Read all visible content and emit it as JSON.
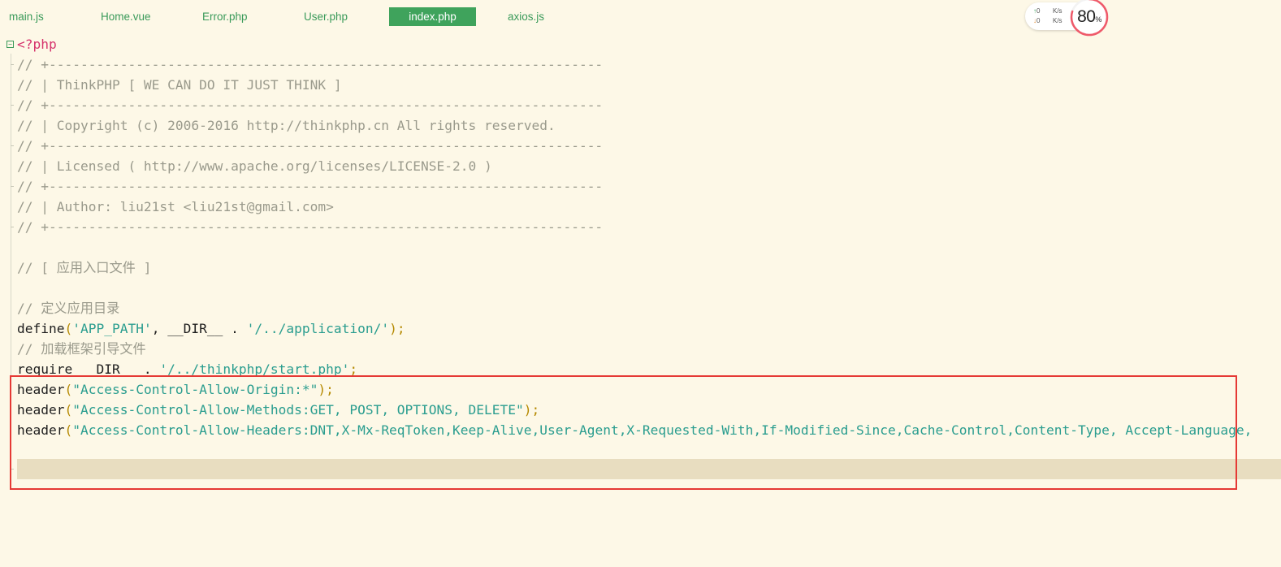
{
  "tabs": [
    {
      "label": "main.js",
      "active": false
    },
    {
      "label": "Home.vue",
      "active": false
    },
    {
      "label": "Error.php",
      "active": false
    },
    {
      "label": "User.php",
      "active": false
    },
    {
      "label": "index.php",
      "active": true
    },
    {
      "label": "axios.js",
      "active": false
    }
  ],
  "network": {
    "upload_value": "0",
    "upload_unit": "K/s",
    "download_value": "0",
    "download_unit": "K/s",
    "usage_value": "80",
    "usage_unit": "%",
    "usage_percent": 80
  },
  "code": {
    "l1": {
      "a": "<?php"
    },
    "l2": {
      "a": "// +----------------------------------------------------------------------"
    },
    "l3": {
      "a": "// | ThinkPHP [ WE CAN DO IT JUST THINK ]"
    },
    "l4": {
      "a": "// +----------------------------------------------------------------------"
    },
    "l5": {
      "a": "// | Copyright (c) 2006-2016 http://thinkphp.cn All rights reserved."
    },
    "l6": {
      "a": "// +----------------------------------------------------------------------"
    },
    "l7": {
      "a": "// | Licensed ( http://www.apache.org/licenses/LICENSE-2.0 )"
    },
    "l8": {
      "a": "// +----------------------------------------------------------------------"
    },
    "l9": {
      "a": "// | Author: liu21st <liu21st@gmail.com>"
    },
    "l10": {
      "a": "// +----------------------------------------------------------------------"
    },
    "l12": {
      "a": "// [ 应用入口文件 ]"
    },
    "l14": {
      "a": "// 定义应用目录"
    },
    "l15": {
      "a": "define",
      "b": "(",
      "c": "'APP_PATH'",
      "d": ", __DIR__ . ",
      "e": "'/../application/'",
      "f": ");"
    },
    "l16": {
      "a": "// 加载框架引导文件"
    },
    "l17": {
      "a": "require __DIR__ . ",
      "b": "'/../thinkphp/start.php'",
      "c": ";"
    },
    "l18": {
      "a": "header",
      "b": "(",
      "c": "\"Access-Control-Allow-Origin:*\"",
      "d": ");"
    },
    "l19": {
      "a": "header",
      "b": "(",
      "c": "\"Access-Control-Allow-Methods:GET, POST, OPTIONS, DELETE\"",
      "d": ");"
    },
    "l20": {
      "a": "header",
      "b": "(",
      "c": "\"Access-Control-Allow-Headers:DNT,X-Mx-ReqToken,Keep-Alive,User-Agent,X-Requested-With,If-Modified-Since,Cache-Control,Content-Type, Accept-Language,"
    }
  },
  "colors": {
    "background": "#fdf8e7",
    "tab_active": "#3fa35c",
    "tab_text": "#3a9a5a",
    "comment": "#9a9a8c",
    "string": "#2a9d8f",
    "php_tag": "#d6336c",
    "highlight_border": "#e53935",
    "current_line": "#e8ddc0"
  }
}
